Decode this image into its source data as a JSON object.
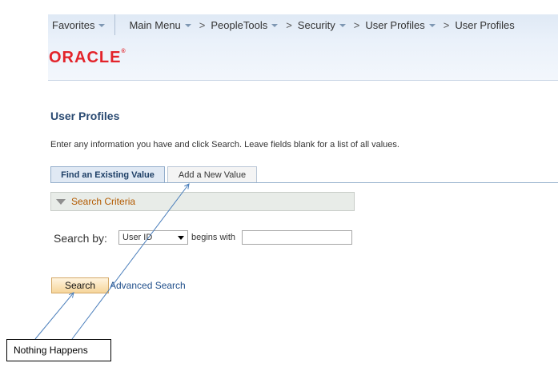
{
  "nav": {
    "favorites": "Favorites",
    "main_menu": "Main Menu",
    "peopletools": "PeopleTools",
    "security": "Security",
    "user_profiles_menu": "User Profiles",
    "current": "User Profiles",
    "separator": ">"
  },
  "logo": {
    "text": "ORACLE",
    "mark": "®"
  },
  "page": {
    "title": "User Profiles",
    "instructions": "Enter any information you have and click Search. Leave fields blank for a list of all values."
  },
  "tabs": [
    {
      "label": "Find an Existing Value",
      "active": true
    },
    {
      "label": "Add a New Value",
      "active": false
    }
  ],
  "search": {
    "criteria_label": "Search Criteria",
    "search_by_label": "Search by:",
    "field_selected": "User ID",
    "operator": "begins with",
    "value": "",
    "search_button": "Search",
    "advanced_link": "Advanced Search"
  },
  "annotation": {
    "text": "Nothing Happens"
  },
  "colors": {
    "oracle_red": "#e3232a",
    "title_blue": "#2a4a72",
    "criteria_orange": "#b35a00",
    "link_blue": "#1f4e8a"
  }
}
